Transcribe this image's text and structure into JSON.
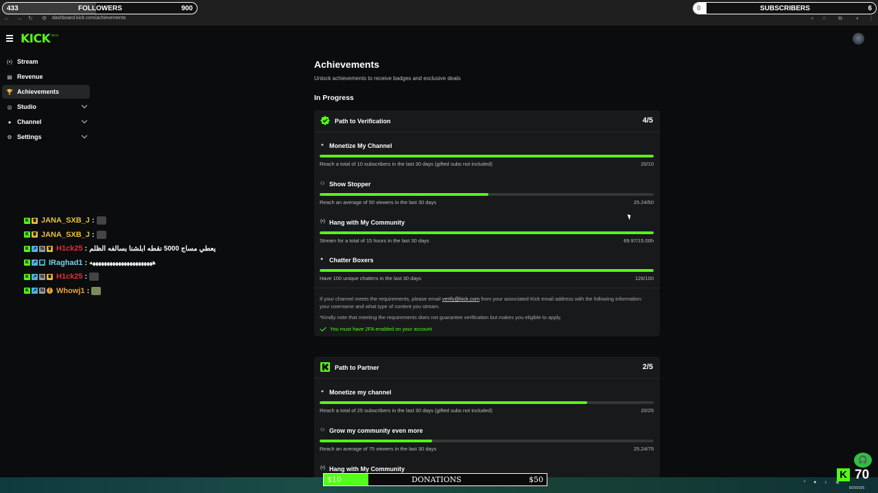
{
  "browser": {
    "url": "dashboard.kick.com/achievements"
  },
  "overlay": {
    "followers": {
      "current": "433",
      "label": "FOLLOWERS",
      "goal": "900",
      "progress": 0.48
    },
    "subscribers": {
      "current": "0",
      "label": "SUBSCRIBERS",
      "goal": "6",
      "progress": 0.02
    }
  },
  "brand": {
    "logo": "KICK",
    "badge": "BETA",
    "accent": "#53fc18"
  },
  "sidebar": {
    "items": [
      {
        "label": "Stream",
        "icon": "broadcast-icon",
        "glyph": "(•)"
      },
      {
        "label": "Revenue",
        "icon": "wallet-icon",
        "glyph": "▤"
      },
      {
        "label": "Achievements",
        "icon": "trophy-icon",
        "glyph": "🏆"
      },
      {
        "label": "Studio",
        "icon": "studio-icon",
        "glyph": "◎"
      },
      {
        "label": "Channel",
        "icon": "user-icon",
        "glyph": "●"
      },
      {
        "label": "Settings",
        "icon": "gear-icon",
        "glyph": "⚙"
      }
    ]
  },
  "chat": [
    {
      "user": "JANA_SXB_J",
      "color": "#e8c33a",
      "msg": ""
    },
    {
      "user": "JANA_SXB_J",
      "color": "#e8c33a",
      "msg": ""
    },
    {
      "user": "H1ck25",
      "color": "#e0303a",
      "msg": "يعطي مساج 5000 نقطه ابلشنا بسالفه الظلم"
    },
    {
      "user": "IRaghad1",
      "color": "#7ad0ea",
      "msg": "ههههههههههههههههههههههه"
    },
    {
      "user": "H1ck25",
      "color": "#e0303a",
      "msg": ""
    },
    {
      "user": "Whowj1",
      "color": "#e8a33a",
      "msg": ""
    }
  ],
  "page": {
    "title": "Achievements",
    "subtitle": "Unlock achievements to receive badges and exclusive deals",
    "section": "In Progress"
  },
  "verification": {
    "title": "Path to Verification",
    "count": "4/5",
    "items": [
      {
        "icon": "sparkle-icon",
        "glyph": "✦",
        "title": "Monetize My Channel",
        "desc": "Reach a total of 10 subscribers in the last 30 days (gifted subs not included)",
        "value": "20/10",
        "progress": 1.0
      },
      {
        "icon": "viewers-icon",
        "glyph": "⚇",
        "title": "Show Stopper",
        "desc": "Reach an average of 50 viewers in the last 30 days",
        "value": "25.24/50",
        "progress": 0.505
      },
      {
        "icon": "broadcast-icon",
        "glyph": "(•)",
        "title": "Hang with My Community",
        "desc": "Stream for a total of 15 hours in the last 30 days",
        "value": "69.97/15.00h",
        "progress": 1.0
      },
      {
        "icon": "chat-bubble-icon",
        "glyph": "●",
        "title": "Chatter Boxers",
        "desc": "Have 100 unique chatters in the last 30 days",
        "value": "126/100",
        "progress": 1.0
      }
    ],
    "footer": {
      "p1_before": "If your channel meets the requirements, please email ",
      "email": "verify@kick.com",
      "p1_after": " from your associated Kick email address with the following information: your username and what type of content you stream.",
      "note": "*Kindly note that meeting the requirements does not guarantee verification but makes you eligible to apply.",
      "twofa": "You must have 2FA enabled on your account"
    }
  },
  "partner": {
    "title": "Path to Partner",
    "count": "2/5",
    "items": [
      {
        "icon": "sparkle-icon",
        "glyph": "✦",
        "title": "Monetize my channel",
        "desc": "Reach a total of 25 subscribers in the last 30 days (gifted subs not included)",
        "value": "20/25",
        "progress": 0.8
      },
      {
        "icon": "viewers-icon",
        "glyph": "⚇",
        "title": "Grow my community even more",
        "desc": "Reach an average of 75 viewers in the last 30 days",
        "value": "25.24/75",
        "progress": 0.336
      },
      {
        "icon": "broadcast-icon",
        "glyph": "(•)",
        "title": "Hang with My Community",
        "desc": "",
        "value": "",
        "progress": 0
      }
    ]
  },
  "donations": {
    "current": "$10",
    "label": "DONATIONS",
    "goal": "$50",
    "progress": 0.2
  },
  "stream_widget": {
    "viewers": "70",
    "date": "8/29/2025"
  }
}
